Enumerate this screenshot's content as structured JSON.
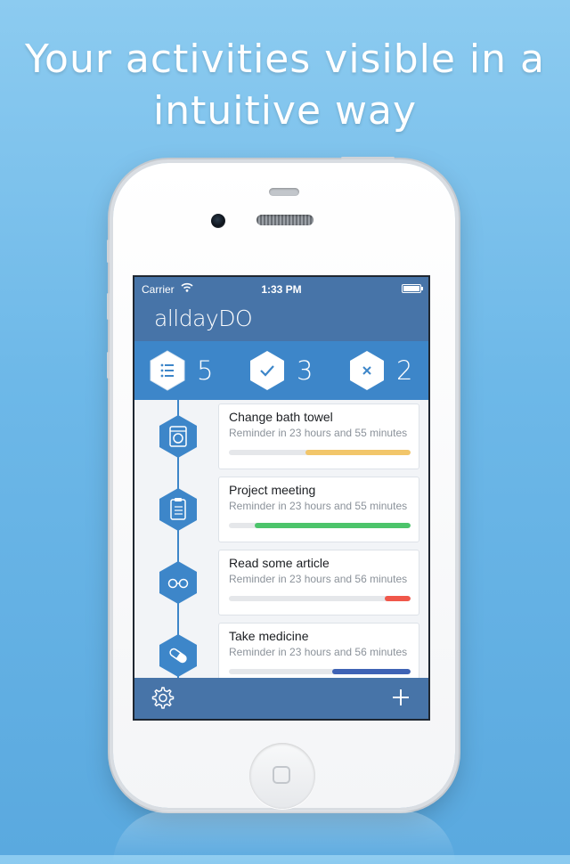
{
  "headline": {
    "line1": "Your activities visible in a",
    "line2": "intuitive way"
  },
  "status_bar": {
    "carrier": "Carrier",
    "time": "1:33 PM"
  },
  "app": {
    "title": "alldayDO"
  },
  "counters": [
    {
      "icon": "list-icon",
      "value": "5"
    },
    {
      "icon": "check-icon",
      "value": "3"
    },
    {
      "icon": "close-icon",
      "value": "2"
    }
  ],
  "activities": [
    {
      "icon": "washing-machine-icon",
      "title": "Change bath towel",
      "reminder": "Reminder in 23 hours and 55 minutes",
      "progress": 0.58,
      "color": "#f2c66a"
    },
    {
      "icon": "clipboard-icon",
      "title": "Project meeting",
      "reminder": "Reminder in 23 hours and 55 minutes",
      "progress": 0.86,
      "color": "#4cc46b"
    },
    {
      "icon": "glasses-icon",
      "title": "Read some article",
      "reminder": "Reminder in 23 hours and 56 minutes",
      "progress": 0.14,
      "color": "#f0574a"
    },
    {
      "icon": "pill-icon",
      "title": "Take medicine",
      "reminder": "Reminder in 23 hours and 56 minutes",
      "progress": 0.43,
      "color": "#3f63b5"
    }
  ],
  "colors": {
    "primary": "#4774a8",
    "accent": "#3d86c9",
    "background": "#6db8e8"
  },
  "toolbar": {
    "settings_icon": "gear-icon",
    "add_icon": "plus-icon"
  }
}
